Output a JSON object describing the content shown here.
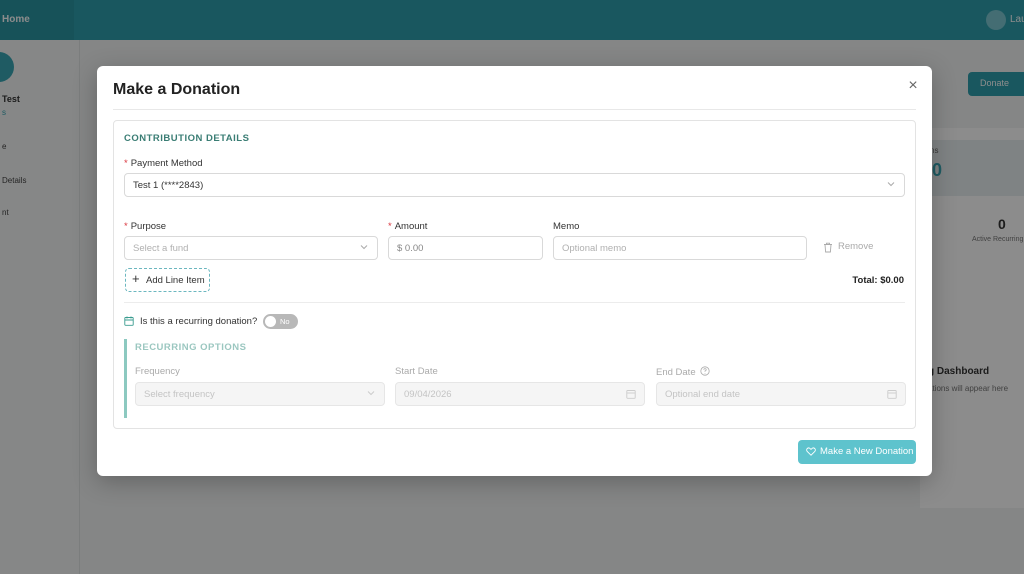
{
  "background": {
    "brand": "Home",
    "user": "Lau",
    "sidebar": {
      "name": "Test",
      "sub": "s",
      "items": [
        "e",
        "Details",
        "nt"
      ]
    },
    "main_button": "Donate",
    "stat_label": "ns",
    "stat_value": "0",
    "count_value": "0",
    "count_label": "Active Recurring",
    "dashboard_title": "g Dashboard",
    "dashboard_sub": "ations will appear here"
  },
  "modal": {
    "title": "Make a Donation",
    "close_label": "×",
    "contribution": {
      "heading": "CONTRIBUTION DETAILS",
      "payment_method": {
        "label": "Payment Method",
        "required_mark": "*",
        "value": "Test 1 (****2843)"
      },
      "line_item": {
        "purpose": {
          "label": "Purpose",
          "required_mark": "*",
          "placeholder": "Select a fund"
        },
        "amount": {
          "label": "Amount",
          "required_mark": "*",
          "placeholder": "$ 0.00"
        },
        "memo": {
          "label": "Memo",
          "placeholder": "Optional memo"
        },
        "remove_label": "Remove"
      },
      "add_line_item": "Add Line Item",
      "add_icon": "+",
      "total": "Total: $0.00",
      "recurring_question": "Is this a recurring donation?",
      "recurring_toggle": "No",
      "recurring": {
        "heading": "RECURRING OPTIONS",
        "frequency": {
          "label": "Frequency",
          "placeholder": "Select frequency"
        },
        "start_date": {
          "label": "Start Date",
          "placeholder": "09/04/2026"
        },
        "end_date": {
          "label": "End Date",
          "placeholder": "Optional end date"
        }
      }
    },
    "submit_label": "Make a New Donation"
  },
  "colors": {
    "accent": "#5ec3cd",
    "header": "#2f9fae",
    "heading_green": "#3a7d74",
    "required": "#d9363e"
  }
}
